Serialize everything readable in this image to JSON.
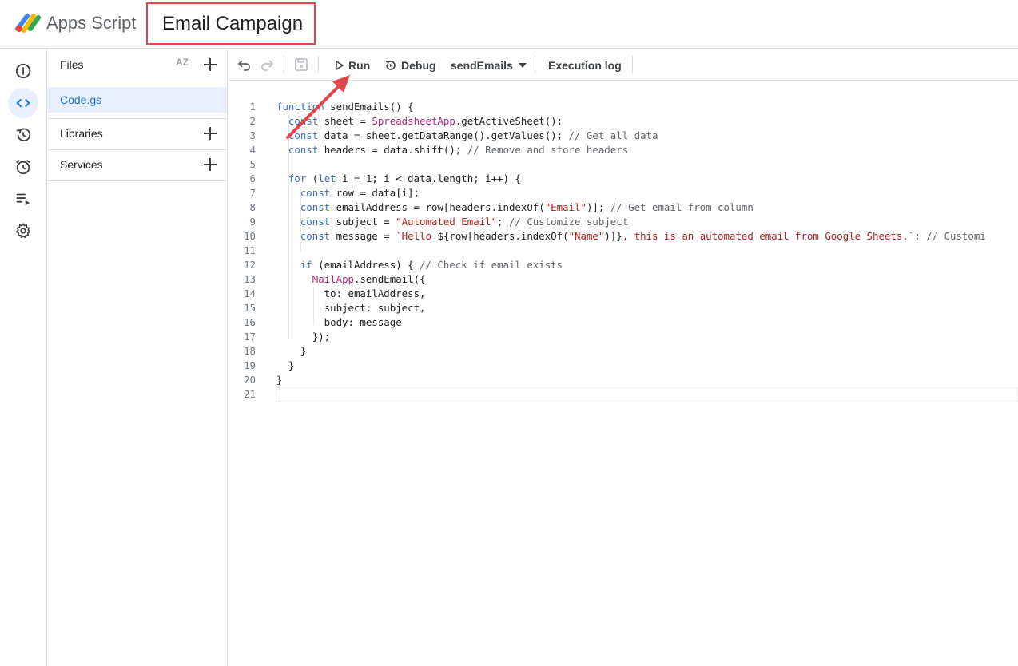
{
  "header": {
    "app_name": "Apps Script",
    "project_title": "Email Campaign"
  },
  "rail": {
    "items": [
      {
        "name": "overview",
        "icon": "info-icon"
      },
      {
        "name": "editor",
        "icon": "code-icon",
        "active": true
      },
      {
        "name": "history",
        "icon": "history-icon"
      },
      {
        "name": "triggers",
        "icon": "alarm-icon"
      },
      {
        "name": "executions",
        "icon": "executions-icon"
      },
      {
        "name": "settings",
        "icon": "gear-icon"
      }
    ]
  },
  "files_panel": {
    "files_label": "Files",
    "sort_label": "AZ",
    "files": [
      "Code.gs"
    ],
    "libraries_label": "Libraries",
    "services_label": "Services"
  },
  "toolbar": {
    "run_label": "Run",
    "debug_label": "Debug",
    "function_select": "sendEmails",
    "execution_log_label": "Execution log"
  },
  "editor": {
    "lines": [
      {
        "n": "1",
        "code": "function sendEmails() {"
      },
      {
        "n": "2",
        "code": "  const sheet = SpreadsheetApp.getActiveSheet();"
      },
      {
        "n": "3",
        "code": "  const data = sheet.getDataRange().getValues(); // Get all data"
      },
      {
        "n": "4",
        "code": "  const headers = data.shift(); // Remove and store headers"
      },
      {
        "n": "5",
        "code": ""
      },
      {
        "n": "6",
        "code": "  for (let i = 1; i < data.length; i++) {"
      },
      {
        "n": "7",
        "code": "    const row = data[i];"
      },
      {
        "n": "8",
        "code": "    const emailAddress = row[headers.indexOf(\"Email\")]; // Get email from column"
      },
      {
        "n": "9",
        "code": "    const subject = \"Automated Email\"; // Customize subject"
      },
      {
        "n": "10",
        "code": "    const message = `Hello ${row[headers.indexOf(\"Name\")]}, this is an automated email from Google Sheets.`; // Customi"
      },
      {
        "n": "11",
        "code": ""
      },
      {
        "n": "12",
        "code": "    if (emailAddress) { // Check if email exists"
      },
      {
        "n": "13",
        "code": "      MailApp.sendEmail({"
      },
      {
        "n": "14",
        "code": "        to: emailAddress,"
      },
      {
        "n": "15",
        "code": "        subject: subject,"
      },
      {
        "n": "16",
        "code": "        body: message"
      },
      {
        "n": "17",
        "code": "      });"
      },
      {
        "n": "18",
        "code": "    }"
      },
      {
        "n": "19",
        "code": "  }"
      },
      {
        "n": "20",
        "code": "}"
      },
      {
        "n": "21",
        "code": ""
      }
    ]
  },
  "colors": {
    "accent": "#1a73e8",
    "highlight_box": "#e0454b",
    "arrow": "#e0454b"
  }
}
